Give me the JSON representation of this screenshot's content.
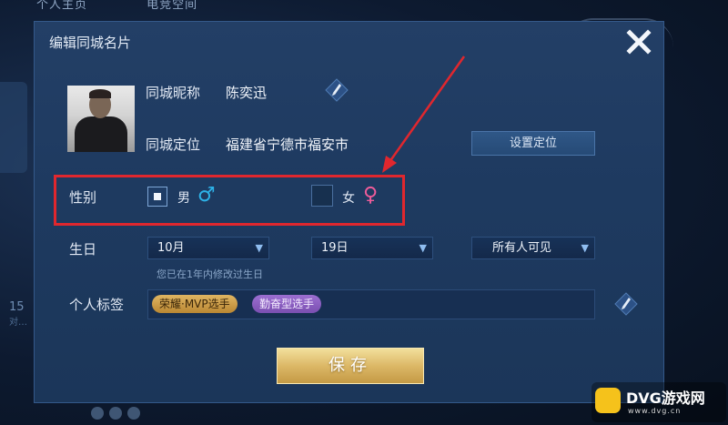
{
  "background": {
    "tabs": [
      "个人主页",
      "电竞空间"
    ],
    "left_number": "15",
    "left_sub": "对…"
  },
  "dialog": {
    "title": "编辑同城名片",
    "nickname_label": "同城昵称",
    "nickname_value": "陈奕迅",
    "location_label": "同城定位",
    "location_value": "福建省宁德市福安市",
    "set_location_button": "设置定位",
    "gender_label": "性别",
    "gender_options": [
      {
        "label": "男",
        "symbol": "♂",
        "selected": true,
        "color": "#2db2e8"
      },
      {
        "label": "女",
        "symbol": "♀",
        "selected": false,
        "color": "#ef5c9a"
      }
    ],
    "birthday_label": "生日",
    "birthday_month": "10月",
    "birthday_day": "19日",
    "birthday_visibility": "所有人可见",
    "birthday_hint": "您已在1年内修改过生日",
    "tags_label": "个人标签",
    "tags": [
      "荣耀·MVP选手",
      "勤奋型选手"
    ],
    "save_button": "保存"
  },
  "annotation": {
    "highlight_color": "#e0272e"
  },
  "watermark": {
    "brand": "DVG游戏网",
    "url": "www.dvg.cn"
  },
  "colors": {
    "dialog_bg": "#1e3a60",
    "accent_blue": "#8fbdf0",
    "save_gold": "#dcb867"
  }
}
